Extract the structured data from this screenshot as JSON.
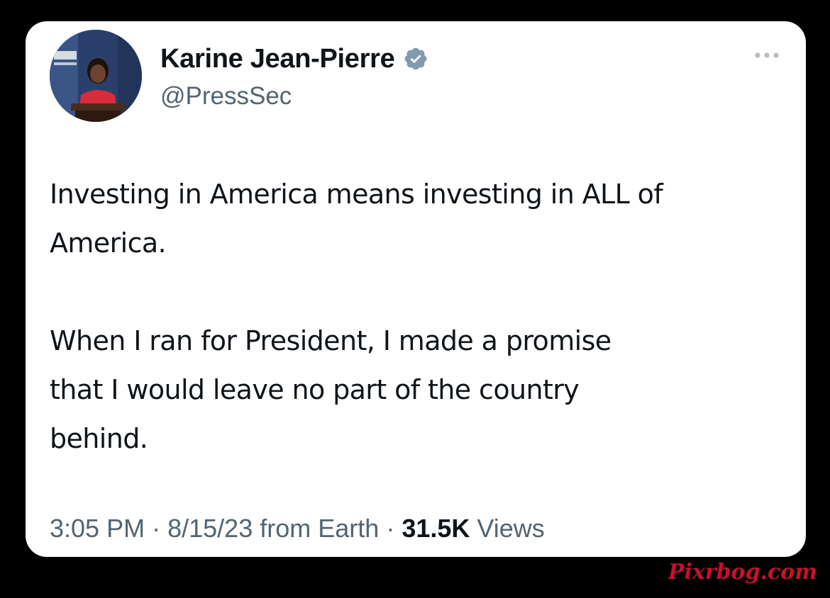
{
  "author": {
    "display_name": "Karine Jean-Pierre",
    "handle": "@PressSec",
    "verified": true,
    "verified_badge_color": "#829aab"
  },
  "tweet": {
    "paragraphs": [
      "Investing in America means investing in ALL of\nAmerica.",
      "When I ran for President, I made a promise\nthat I would leave no part of the country\nbehind."
    ]
  },
  "meta": {
    "time": "3:05 PM",
    "separator": "·",
    "date": "8/15/23",
    "source": "from Earth",
    "views_count": "31.5K",
    "views_label": "Views"
  },
  "icons": {
    "more": "more-options-icon",
    "verified": "verified-badge-icon"
  },
  "watermark": "Pixrbog.com",
  "colors": {
    "background": "#000000",
    "card": "#ffffff",
    "text_primary": "#0f1419",
    "text_secondary": "#536471",
    "watermark": "#c8102e"
  }
}
